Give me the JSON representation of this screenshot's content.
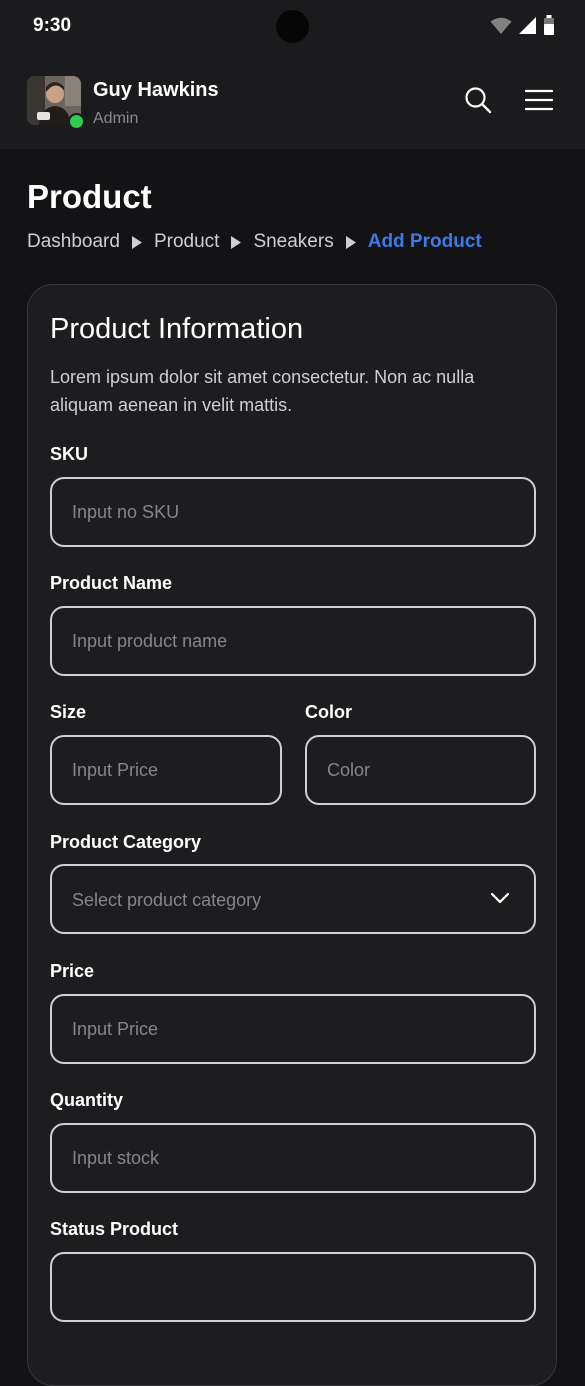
{
  "status_bar": {
    "time": "9:30"
  },
  "header": {
    "user_name": "Guy Hawkins",
    "user_role": "Admin",
    "status_color": "#2ecc4f",
    "search_icon": "search-icon",
    "menu_icon": "hamburger-menu-icon"
  },
  "page": {
    "title": "Product",
    "breadcrumb": [
      "Dashboard",
      "Product",
      "Sneakers",
      "Add Product"
    ],
    "accent_color": "#3b7be8"
  },
  "card": {
    "title": "Product Information",
    "description": "Lorem ipsum dolor sit amet consectetur. Non ac nulla aliquam aenean in velit mattis.",
    "fields": {
      "sku": {
        "label": "SKU",
        "placeholder": "Input no SKU"
      },
      "product_name": {
        "label": "Product Name",
        "placeholder": "Input product name"
      },
      "size": {
        "label": "Size",
        "placeholder": "Input Price"
      },
      "color": {
        "label": "Color",
        "placeholder": "Color"
      },
      "category": {
        "label": "Product Category",
        "placeholder": "Select product category"
      },
      "price": {
        "label": "Price",
        "placeholder": "Input Price"
      },
      "quantity": {
        "label": "Quantity",
        "placeholder": "Input stock"
      },
      "status": {
        "label": "Status Product"
      }
    }
  }
}
